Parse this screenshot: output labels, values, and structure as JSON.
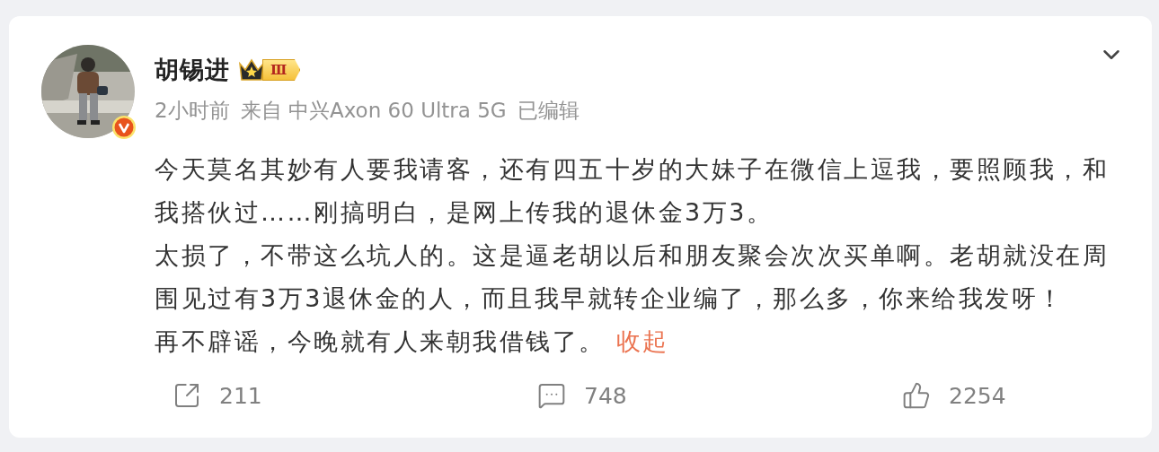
{
  "post": {
    "author": {
      "name": "胡锡进",
      "badge_text": "Ⅲ",
      "verified": true
    },
    "meta": {
      "time": "2小时前",
      "source": "来自 中兴Axon 60 Ultra 5G",
      "edited": "已编辑"
    },
    "paragraphs": [
      {
        "lines": [
          "今天莫名其妙有人要我请客，还有四五十岁的大妹子在微信上逗我，要照顾我，和",
          "我搭伙过……刚搞明白，是网上传我的退休金3万3。"
        ]
      },
      {
        "lines": [
          "太损了，不带这么坑人的。这是逼老胡以后和朋友聚会次次买单啊。老胡就没在周",
          "围见过有3万3退休金的人，而且我早就转企业编了，那么多，你来给我发呀！"
        ]
      },
      {
        "lines": [
          "再不辟谣，今晚就有人来朝我借钱了。"
        ],
        "link": "收起"
      }
    ],
    "actions": [
      {
        "kind": "repost",
        "count": "211"
      },
      {
        "kind": "comment",
        "count": "748"
      },
      {
        "kind": "like",
        "count": "2254"
      }
    ]
  }
}
